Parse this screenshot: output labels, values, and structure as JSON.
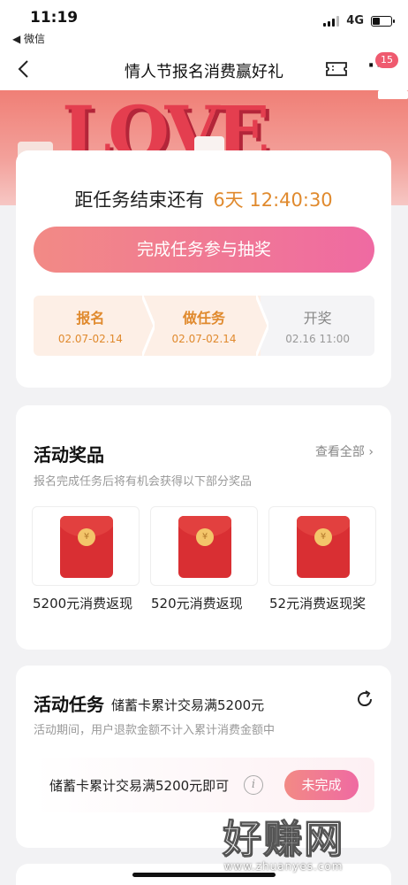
{
  "status_bar": {
    "time": "11:19",
    "back_app": "◀ 微信",
    "network": "4G"
  },
  "nav": {
    "title": "情人节报名消费赢好礼",
    "badge_count": "15",
    "more": "···"
  },
  "banner": {
    "text": "LOVE"
  },
  "countdown": {
    "label": "距任务结束还有",
    "value": "6天  12:40:30"
  },
  "cta": {
    "label": "完成任务参与抽奖"
  },
  "steps": [
    {
      "name": "报名",
      "date": "02.07-02.14",
      "state": "done"
    },
    {
      "name": "做任务",
      "date": "02.07-02.14",
      "state": "done"
    },
    {
      "name": "开奖",
      "date": "02.16 11:00",
      "state": "pending"
    }
  ],
  "prizes_section": {
    "title": "活动奖品",
    "view_all": "查看全部",
    "subtitle": "报名完成任务后将有机会获得以下部分奖品",
    "items": [
      {
        "name": "5200元消费返现"
      },
      {
        "name": "520元消费返现"
      },
      {
        "name": "52元消费返现奖"
      }
    ]
  },
  "tasks_section": {
    "title": "活动任务",
    "subtitle": "储蓄卡累计交易满5200元",
    "note": "活动期间，用户退款金额不计入累计消费金额中",
    "task": {
      "name": "储蓄卡累计交易满5200元即可",
      "status": "未完成"
    }
  },
  "watermark": {
    "main": "好赚网",
    "url": "www.zhuanyes.com"
  },
  "colors": {
    "accent_orange": "#e08a2e",
    "button_gradient_start": "#f28a85",
    "button_gradient_end": "#ef6aa2",
    "badge": "#ef5a6f"
  }
}
